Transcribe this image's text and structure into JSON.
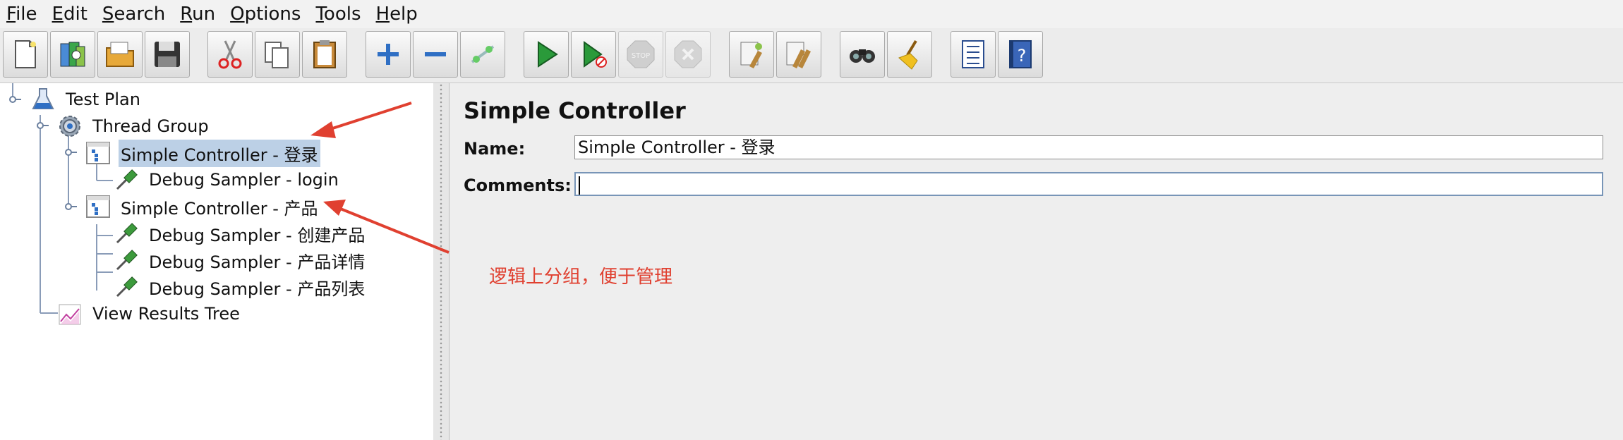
{
  "menu": {
    "items": [
      {
        "mnemonic": "F",
        "rest": "ile"
      },
      {
        "mnemonic": "E",
        "rest": "dit"
      },
      {
        "mnemonic": "S",
        "rest": "earch"
      },
      {
        "mnemonic": "R",
        "rest": "un"
      },
      {
        "mnemonic": "O",
        "rest": "ptions"
      },
      {
        "mnemonic": "T",
        "rest": "ools"
      },
      {
        "mnemonic": "H",
        "rest": "elp"
      }
    ]
  },
  "toolbar": {
    "buttons": [
      "new-icon",
      "templates-icon",
      "open-icon",
      "save-icon",
      "cut-icon",
      "copy-icon",
      "paste-icon",
      "expand-icon",
      "collapse-icon",
      "toggle-icon",
      "start-icon",
      "start-no-pause-icon",
      "stop-icon",
      "shutdown-icon",
      "clear-icon",
      "clear-all-icon",
      "search-icon",
      "reset-search-icon",
      "function-helper-icon",
      "help-icon"
    ]
  },
  "tree": {
    "nodes": [
      {
        "label": "Test Plan",
        "icon": "flask-icon"
      },
      {
        "label": "Thread Group",
        "icon": "gear-icon"
      },
      {
        "label": "Simple Controller - 登录",
        "icon": "controller-icon",
        "selected": true
      },
      {
        "label": "Debug Sampler - login",
        "icon": "pipette-icon"
      },
      {
        "label": "Simple Controller - 产品",
        "icon": "controller-icon"
      },
      {
        "label": "Debug Sampler - 创建产品",
        "icon": "pipette-icon"
      },
      {
        "label": "Debug Sampler - 产品详情",
        "icon": "pipette-icon"
      },
      {
        "label": "Debug Sampler - 产品列表",
        "icon": "pipette-icon"
      },
      {
        "label": "View Results Tree",
        "icon": "chart-icon"
      }
    ]
  },
  "editor": {
    "title": "Simple Controller",
    "name_label": "Name:",
    "name_value": "Simple Controller - 登录",
    "comments_label": "Comments:",
    "comments_value": ""
  },
  "annotation": {
    "text": "逻辑上分组，便于管理",
    "color": "#e04030"
  }
}
